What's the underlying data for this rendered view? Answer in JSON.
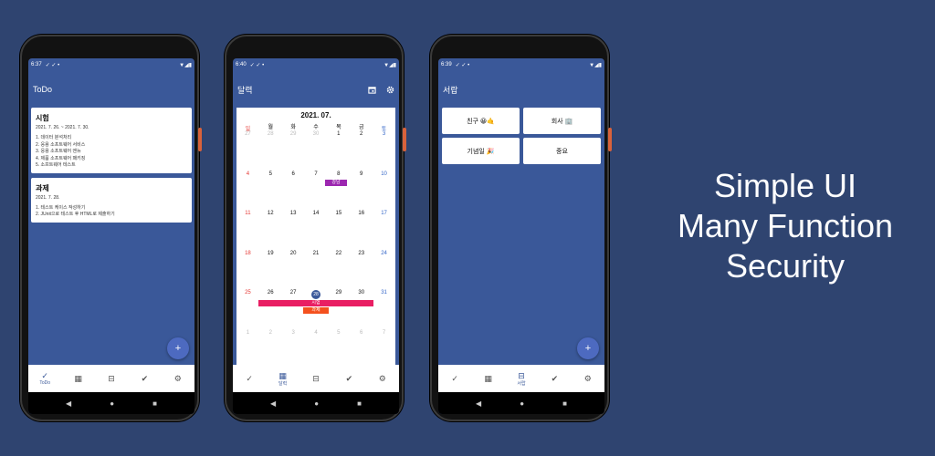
{
  "phone1": {
    "status": {
      "time": "6:37",
      "left_icons": "✓ ✓ •",
      "right_icons": "▼◢▮"
    },
    "app_title": "ToDo",
    "cards": [
      {
        "title": "시험",
        "date": "2021. 7. 26. ~ 2021. 7. 30.",
        "items": [
          "1. 데이터 분석처리",
          "2. 응용 소프트웨어 서비스",
          "3. 응용 소프트웨어 엔뉴",
          "4. 제품 소프트웨어 패키징",
          "5. 소프트웨어 테스트"
        ]
      },
      {
        "title": "과제",
        "date": "2021. 7. 28.",
        "items": [
          "1. 테스트 케이스 작성하기",
          "2. JUnit으로 테스트 후 HTML로 제출하기"
        ]
      }
    ],
    "fab": "+",
    "nav": [
      {
        "glyph": "✓",
        "label": "ToDo"
      },
      {
        "glyph": "▦",
        "label": ""
      },
      {
        "glyph": "⊟",
        "label": ""
      },
      {
        "glyph": "✔",
        "label": ""
      },
      {
        "glyph": "⚙",
        "label": ""
      }
    ]
  },
  "phone2": {
    "status": {
      "time": "6:40",
      "left_icons": "✓ ✓ •",
      "right_icons": "▼◢▮"
    },
    "app_title": "달력",
    "calendar": {
      "month": "2021. 07.",
      "weekdays": [
        "일",
        "월",
        "화",
        "수",
        "목",
        "금",
        "토"
      ],
      "weeks": [
        [
          "27",
          "28",
          "29",
          "30",
          "1",
          "2",
          "3"
        ],
        [
          "4",
          "5",
          "6",
          "7",
          "8",
          "9",
          "10"
        ],
        [
          "11",
          "12",
          "13",
          "14",
          "15",
          "16",
          "17"
        ],
        [
          "18",
          "19",
          "20",
          "21",
          "22",
          "23",
          "24"
        ],
        [
          "25",
          "26",
          "27",
          "28",
          "29",
          "30",
          "31"
        ],
        [
          "1",
          "2",
          "3",
          "4",
          "5",
          "6",
          "7"
        ]
      ],
      "events": [
        {
          "label": "강남",
          "color": "#9c27b0"
        },
        {
          "label": "시험",
          "color": "#e91e63"
        },
        {
          "label": "과제",
          "color": "#f4511e"
        }
      ]
    },
    "nav": [
      {
        "glyph": "✓",
        "label": ""
      },
      {
        "glyph": "▦",
        "label": "달력"
      },
      {
        "glyph": "⊟",
        "label": ""
      },
      {
        "glyph": "✔",
        "label": ""
      },
      {
        "glyph": "⚙",
        "label": ""
      }
    ]
  },
  "phone3": {
    "status": {
      "time": "6:39",
      "left_icons": "✓ ✓ •",
      "right_icons": "▼◢▮"
    },
    "app_title": "서랍",
    "folders": [
      "친구 😀🤙",
      "회사 🏢",
      "기념일 🎉",
      "중요"
    ],
    "fab": "+",
    "nav": [
      {
        "glyph": "✓",
        "label": ""
      },
      {
        "glyph": "▦",
        "label": ""
      },
      {
        "glyph": "⊟",
        "label": "서랍"
      },
      {
        "glyph": "✔",
        "label": ""
      },
      {
        "glyph": "⚙",
        "label": ""
      }
    ]
  },
  "system_nav": [
    "◀",
    "●",
    "■"
  ],
  "tagline": [
    "Simple UI",
    "Many Function",
    "Security"
  ]
}
